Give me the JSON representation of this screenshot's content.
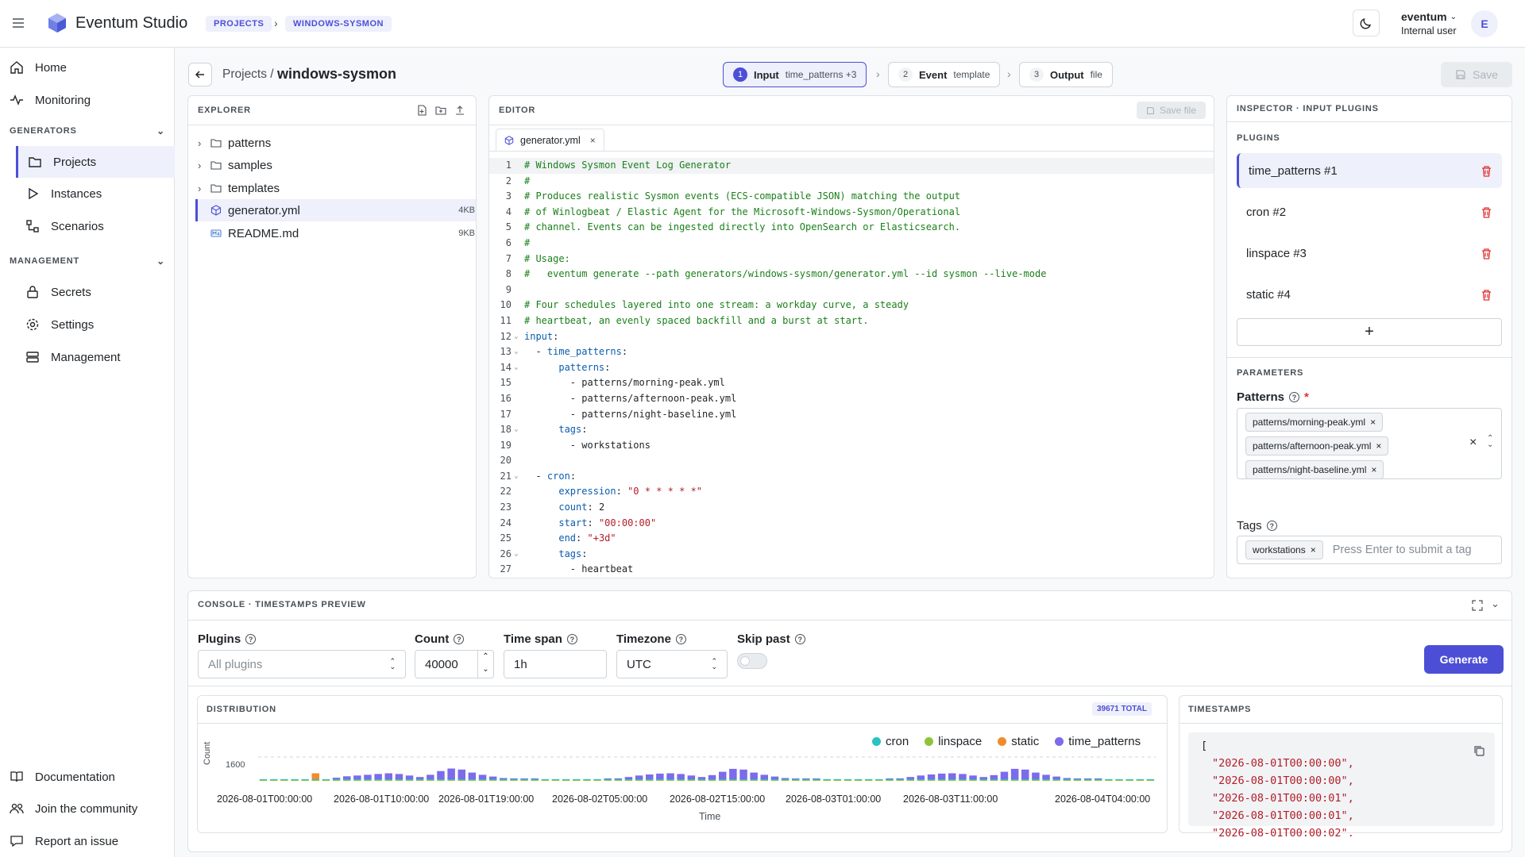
{
  "app": {
    "title": "Eventum Studio"
  },
  "breadcrumb": {
    "projects": "PROJECTS",
    "project": "WINDOWS-SYSMON"
  },
  "user": {
    "name": "eventum",
    "role": "Internal user",
    "avatar": "E"
  },
  "sidebar": {
    "home": "Home",
    "monitoring": "Monitoring",
    "generators_section": "GENERATORS",
    "projects": "Projects",
    "instances": "Instances",
    "scenarios": "Scenarios",
    "management_section": "MANAGEMENT",
    "secrets": "Secrets",
    "settings": "Settings",
    "management": "Management",
    "documentation": "Documentation",
    "community": "Join the community",
    "report": "Report an issue"
  },
  "page": {
    "breadcrumb_root": "Projects /",
    "title": "windows-sysmon",
    "save_label": "Save"
  },
  "steps": [
    {
      "num": "1",
      "label": "Input",
      "detail": "time_patterns +3"
    },
    {
      "num": "2",
      "label": "Event",
      "detail": "template"
    },
    {
      "num": "3",
      "label": "Output",
      "detail": "file"
    }
  ],
  "explorer": {
    "title": "EXPLORER",
    "items": [
      {
        "name": "patterns",
        "size": ""
      },
      {
        "name": "samples",
        "size": ""
      },
      {
        "name": "templates",
        "size": ""
      },
      {
        "name": "generator.yml",
        "size": "4KB"
      },
      {
        "name": "README.md",
        "size": "9KB"
      }
    ]
  },
  "editor": {
    "title": "EDITOR",
    "save_file": "Save file",
    "tab": "generator.yml",
    "lines": [
      "# Windows Sysmon Event Log Generator",
      "#",
      "# Produces realistic Sysmon events (ECS-compatible JSON) matching the output",
      "# of Winlogbeat / Elastic Agent for the Microsoft-Windows-Sysmon/Operational",
      "# channel. Events can be ingested directly into OpenSearch or Elasticsearch.",
      "#",
      "# Usage:",
      "#   eventum generate --path generators/windows-sysmon/generator.yml --id sysmon --live-mode",
      "",
      "# Four schedules layered into one stream: a workday curve, a steady",
      "# heartbeat, an evenly spaced backfill and a burst at start.",
      "input:",
      "  - time_patterns:",
      "      patterns:",
      "        - patterns/morning-peak.yml",
      "        - patterns/afternoon-peak.yml",
      "        - patterns/night-baseline.yml",
      "      tags:",
      "        - workstations",
      "",
      "  - cron:",
      "      expression: \"0 * * * * *\"",
      "      count: 2",
      "      start: \"00:00:00\"",
      "      end: \"+3d\"",
      "      tags:",
      "        - heartbeat"
    ]
  },
  "inspector": {
    "title": "INSPECTOR · INPUT PLUGINS",
    "plugins_label": "PLUGINS",
    "plugins": [
      "time_patterns #1",
      "cron #2",
      "linspace #3",
      "static #4"
    ],
    "add_symbol": "+",
    "parameters_label": "PARAMETERS",
    "patterns_label": "Patterns",
    "required_mark": "*",
    "patterns": [
      "patterns/morning-peak.yml",
      "patterns/afternoon-peak.yml",
      "patterns/night-baseline.yml"
    ],
    "tags_label": "Tags",
    "tags": [
      "workstations"
    ],
    "tag_placeholder": "Press Enter to submit a tag"
  },
  "console": {
    "title": "CONSOLE · TIMESTAMPS PREVIEW",
    "plugins_label": "Plugins",
    "plugins_placeholder": "All plugins",
    "count_label": "Count",
    "count_value": "40000",
    "timespan_label": "Time span",
    "timespan_value": "1h",
    "timezone_label": "Timezone",
    "timezone_value": "UTC",
    "skip_label": "Skip past",
    "skip_past": false,
    "generate_label": "Generate"
  },
  "distribution": {
    "title": "DISTRIBUTION",
    "total_badge": "39671 TOTAL"
  },
  "chart_data": {
    "type": "bar",
    "stacked": true,
    "xlabel": "Time",
    "ylabel": "Count",
    "y_tick": "1600",
    "ylim": [
      0,
      1600
    ],
    "legend_position": "top-right",
    "x_ticks": [
      "2026-08-01T00:00:00",
      "2026-08-01T10:00:00",
      "2026-08-01T19:00:00",
      "2026-08-02T05:00:00",
      "2026-08-02T15:00:00",
      "2026-08-03T01:00:00",
      "2026-08-03T11:00:00",
      "2026-08-04T04:00:00"
    ],
    "series": [
      {
        "name": "cron",
        "color": "#2bc2c2"
      },
      {
        "name": "linspace",
        "color": "#8fc43a"
      },
      {
        "name": "static",
        "color": "#f08c2b"
      },
      {
        "name": "time_patterns",
        "color": "#7c6bea"
      }
    ],
    "bars": [
      {
        "cron": 40,
        "linspace": 40,
        "static": 0,
        "time_patterns": 0
      },
      {
        "cron": 40,
        "linspace": 40,
        "static": 0,
        "time_patterns": 0
      },
      {
        "cron": 40,
        "linspace": 40,
        "static": 0,
        "time_patterns": 0
      },
      {
        "cron": 40,
        "linspace": 40,
        "static": 0,
        "time_patterns": 0
      },
      {
        "cron": 40,
        "linspace": 40,
        "static": 0,
        "time_patterns": 0
      },
      {
        "cron": 40,
        "linspace": 40,
        "static": 400,
        "time_patterns": 0
      },
      {
        "cron": 40,
        "linspace": 40,
        "static": 0,
        "time_patterns": 0
      },
      {
        "cron": 40,
        "linspace": 40,
        "static": 0,
        "time_patterns": 100
      },
      {
        "cron": 40,
        "linspace": 40,
        "static": 0,
        "time_patterns": 200
      },
      {
        "cron": 40,
        "linspace": 40,
        "static": 0,
        "time_patterns": 250
      },
      {
        "cron": 40,
        "linspace": 40,
        "static": 0,
        "time_patterns": 300
      },
      {
        "cron": 40,
        "linspace": 40,
        "static": 0,
        "time_patterns": 350
      },
      {
        "cron": 40,
        "linspace": 40,
        "static": 0,
        "time_patterns": 400
      },
      {
        "cron": 40,
        "linspace": 40,
        "static": 0,
        "time_patterns": 350
      },
      {
        "cron": 40,
        "linspace": 40,
        "static": 0,
        "time_patterns": 250
      },
      {
        "cron": 40,
        "linspace": 40,
        "static": 0,
        "time_patterns": 150
      },
      {
        "cron": 40,
        "linspace": 40,
        "static": 0,
        "time_patterns": 300
      },
      {
        "cron": 40,
        "linspace": 40,
        "static": 0,
        "time_patterns": 550
      },
      {
        "cron": 40,
        "linspace": 40,
        "static": 0,
        "time_patterns": 720
      },
      {
        "cron": 40,
        "linspace": 40,
        "static": 0,
        "time_patterns": 650
      },
      {
        "cron": 40,
        "linspace": 40,
        "static": 0,
        "time_patterns": 450
      },
      {
        "cron": 40,
        "linspace": 40,
        "static": 0,
        "time_patterns": 300
      },
      {
        "cron": 40,
        "linspace": 40,
        "static": 0,
        "time_patterns": 180
      },
      {
        "cron": 40,
        "linspace": 40,
        "static": 0,
        "time_patterns": 80
      },
      {
        "cron": 40,
        "linspace": 40,
        "static": 0,
        "time_patterns": 40
      },
      {
        "cron": 40,
        "linspace": 40,
        "static": 0,
        "time_patterns": 20
      },
      {
        "cron": 40,
        "linspace": 40,
        "static": 0,
        "time_patterns": 10
      },
      {
        "cron": 40,
        "linspace": 40,
        "static": 0,
        "time_patterns": 0
      },
      {
        "cron": 40,
        "linspace": 40,
        "static": 0,
        "time_patterns": 0
      },
      {
        "cron": 40,
        "linspace": 40,
        "static": 0,
        "time_patterns": 0
      },
      {
        "cron": 40,
        "linspace": 40,
        "static": 0,
        "time_patterns": 0
      },
      {
        "cron": 40,
        "linspace": 40,
        "static": 0,
        "time_patterns": 0
      },
      {
        "cron": 40,
        "linspace": 40,
        "static": 0,
        "time_patterns": 0
      },
      {
        "cron": 40,
        "linspace": 40,
        "static": 0,
        "time_patterns": 20
      },
      {
        "cron": 40,
        "linspace": 40,
        "static": 0,
        "time_patterns": 60
      },
      {
        "cron": 40,
        "linspace": 40,
        "static": 0,
        "time_patterns": 150
      },
      {
        "cron": 40,
        "linspace": 40,
        "static": 0,
        "time_patterns": 250
      },
      {
        "cron": 40,
        "linspace": 40,
        "static": 0,
        "time_patterns": 320
      },
      {
        "cron": 40,
        "linspace": 40,
        "static": 0,
        "time_patterns": 380
      },
      {
        "cron": 40,
        "linspace": 40,
        "static": 0,
        "time_patterns": 400
      },
      {
        "cron": 40,
        "linspace": 40,
        "static": 0,
        "time_patterns": 350
      },
      {
        "cron": 40,
        "linspace": 40,
        "static": 0,
        "time_patterns": 250
      },
      {
        "cron": 40,
        "linspace": 40,
        "static": 0,
        "time_patterns": 150
      },
      {
        "cron": 40,
        "linspace": 40,
        "static": 0,
        "time_patterns": 280
      },
      {
        "cron": 40,
        "linspace": 40,
        "static": 0,
        "time_patterns": 500
      },
      {
        "cron": 40,
        "linspace": 40,
        "static": 0,
        "time_patterns": 700
      },
      {
        "cron": 40,
        "linspace": 40,
        "static": 0,
        "time_patterns": 650
      },
      {
        "cron": 40,
        "linspace": 40,
        "static": 0,
        "time_patterns": 450
      },
      {
        "cron": 40,
        "linspace": 40,
        "static": 0,
        "time_patterns": 300
      },
      {
        "cron": 40,
        "linspace": 40,
        "static": 0,
        "time_patterns": 180
      },
      {
        "cron": 40,
        "linspace": 40,
        "static": 0,
        "time_patterns": 80
      },
      {
        "cron": 40,
        "linspace": 40,
        "static": 0,
        "time_patterns": 40
      },
      {
        "cron": 40,
        "linspace": 40,
        "static": 0,
        "time_patterns": 20
      },
      {
        "cron": 40,
        "linspace": 40,
        "static": 0,
        "time_patterns": 10
      },
      {
        "cron": 40,
        "linspace": 40,
        "static": 0,
        "time_patterns": 0
      },
      {
        "cron": 40,
        "linspace": 40,
        "static": 0,
        "time_patterns": 0
      },
      {
        "cron": 40,
        "linspace": 40,
        "static": 0,
        "time_patterns": 0
      },
      {
        "cron": 40,
        "linspace": 40,
        "static": 0,
        "time_patterns": 0
      },
      {
        "cron": 40,
        "linspace": 40,
        "static": 0,
        "time_patterns": 0
      },
      {
        "cron": 40,
        "linspace": 40,
        "static": 0,
        "time_patterns": 0
      },
      {
        "cron": 40,
        "linspace": 40,
        "static": 0,
        "time_patterns": 20
      },
      {
        "cron": 40,
        "linspace": 40,
        "static": 0,
        "time_patterns": 60
      },
      {
        "cron": 40,
        "linspace": 40,
        "static": 0,
        "time_patterns": 150
      },
      {
        "cron": 40,
        "linspace": 40,
        "static": 0,
        "time_patterns": 250
      },
      {
        "cron": 40,
        "linspace": 40,
        "static": 0,
        "time_patterns": 320
      },
      {
        "cron": 40,
        "linspace": 40,
        "static": 0,
        "time_patterns": 380
      },
      {
        "cron": 40,
        "linspace": 40,
        "static": 0,
        "time_patterns": 400
      },
      {
        "cron": 40,
        "linspace": 40,
        "static": 0,
        "time_patterns": 350
      },
      {
        "cron": 40,
        "linspace": 40,
        "static": 0,
        "time_patterns": 250
      },
      {
        "cron": 40,
        "linspace": 40,
        "static": 0,
        "time_patterns": 150
      },
      {
        "cron": 40,
        "linspace": 40,
        "static": 0,
        "time_patterns": 280
      },
      {
        "cron": 40,
        "linspace": 40,
        "static": 0,
        "time_patterns": 500
      },
      {
        "cron": 40,
        "linspace": 40,
        "static": 0,
        "time_patterns": 700
      },
      {
        "cron": 40,
        "linspace": 40,
        "static": 0,
        "time_patterns": 650
      },
      {
        "cron": 40,
        "linspace": 40,
        "static": 0,
        "time_patterns": 450
      },
      {
        "cron": 40,
        "linspace": 40,
        "static": 0,
        "time_patterns": 300
      },
      {
        "cron": 40,
        "linspace": 40,
        "static": 0,
        "time_patterns": 180
      },
      {
        "cron": 40,
        "linspace": 40,
        "static": 0,
        "time_patterns": 80
      },
      {
        "cron": 40,
        "linspace": 40,
        "static": 0,
        "time_patterns": 40
      },
      {
        "cron": 40,
        "linspace": 40,
        "static": 0,
        "time_patterns": 20
      },
      {
        "cron": 40,
        "linspace": 40,
        "static": 0,
        "time_patterns": 10
      },
      {
        "cron": 40,
        "linspace": 40,
        "static": 0,
        "time_patterns": 0
      },
      {
        "cron": 40,
        "linspace": 40,
        "static": 0,
        "time_patterns": 0
      },
      {
        "cron": 40,
        "linspace": 40,
        "static": 0,
        "time_patterns": 0
      },
      {
        "cron": 40,
        "linspace": 40,
        "static": 0,
        "time_patterns": 0
      },
      {
        "cron": 40,
        "linspace": 40,
        "static": 0,
        "time_patterns": 0
      }
    ]
  },
  "timestamps": {
    "title": "TIMESTAMPS",
    "open_bracket": "[",
    "lines": [
      "\"2026-08-01T00:00:00\",",
      "\"2026-08-01T00:00:00\",",
      "\"2026-08-01T00:00:01\",",
      "\"2026-08-01T00:00:01\",",
      "\"2026-08-01T00:00:02\","
    ]
  }
}
